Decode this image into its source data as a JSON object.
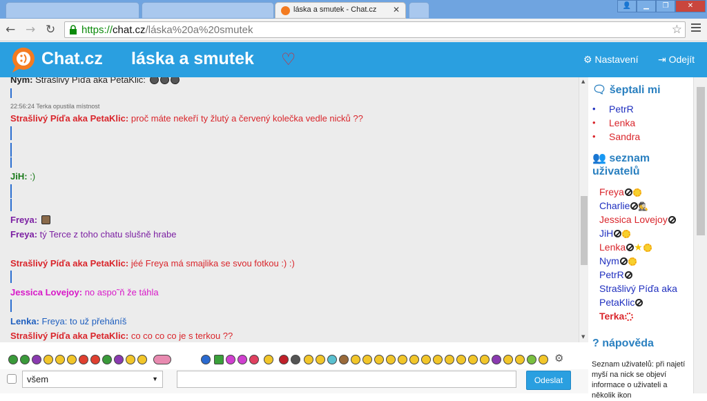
{
  "browser": {
    "tabs": [
      {
        "title": ""
      },
      {
        "title": ""
      },
      {
        "title": "láska a smutek - Chat.cz"
      },
      {
        "title": ""
      }
    ],
    "url_scheme": "https://",
    "url_host": "chat.cz",
    "url_path": "/láska%20a%20smutek"
  },
  "header": {
    "brand": "Chat.cz",
    "room": "láska a smutek",
    "settings": "Nastavení",
    "logout": "Odejít"
  },
  "colors": {
    "accent": "#2a9fe0",
    "red_nick": "#d9252b",
    "purple_nick": "#7b1fa2",
    "green_nick": "#1a7a1a",
    "pink_nick": "#d818c8",
    "blue_nick": "#1f5fbf"
  },
  "chat": {
    "top_partial": {
      "nick": "Nym:",
      "text": "Strašlivý Píďa aka PetaKlic:"
    },
    "system": "22:56:24 Terka opustila místnost",
    "messages": [
      {
        "nick": "Strašlivý Píďa aka PetaKlic:",
        "text": "proč máte nekeří ty žlutý a červený kolečka vedle nicků ??"
      },
      {
        "nick": "JiH:",
        "text": ":)"
      },
      {
        "nick": "Freya:",
        "text": ""
      },
      {
        "nick": "Freya:",
        "text": "tý Terce z toho chatu slušně hrabe"
      },
      {
        "nick": "Strašlivý Píďa aka PetaKlic:",
        "text": "jéé Freya má smajlika se svou fotkou :) :)"
      },
      {
        "nick": "Jessica Lovejoy:",
        "text": "no aspo˜ň že táhla"
      },
      {
        "nick": "Lenka:",
        "text": "Freya: to už přeháníš"
      },
      {
        "nick": "Strašlivý Píďa aka PetaKlic:",
        "text": "co co co co je s terkou ??"
      }
    ]
  },
  "sidebar": {
    "whisper_title": "šeptali mi",
    "whispered": [
      "PetrR",
      "Lenka",
      "Sandra"
    ],
    "users_title": "seznam uživatelů",
    "users": [
      "Freya",
      "Charlie",
      "Jessica Lovejoy",
      "JiH",
      "Lenka",
      "Nym",
      "PetrR",
      "Strašlivý Píďa aka",
      "PetaKlic",
      "Terka"
    ],
    "help_title": "nápověda",
    "help_text": "Seznam uživatelů: při najetí myší na nick se objeví informace o uživateli a několik ikon"
  },
  "footer": {
    "recipient": "všem",
    "message_placeholder": "",
    "send": "Odeslat"
  }
}
